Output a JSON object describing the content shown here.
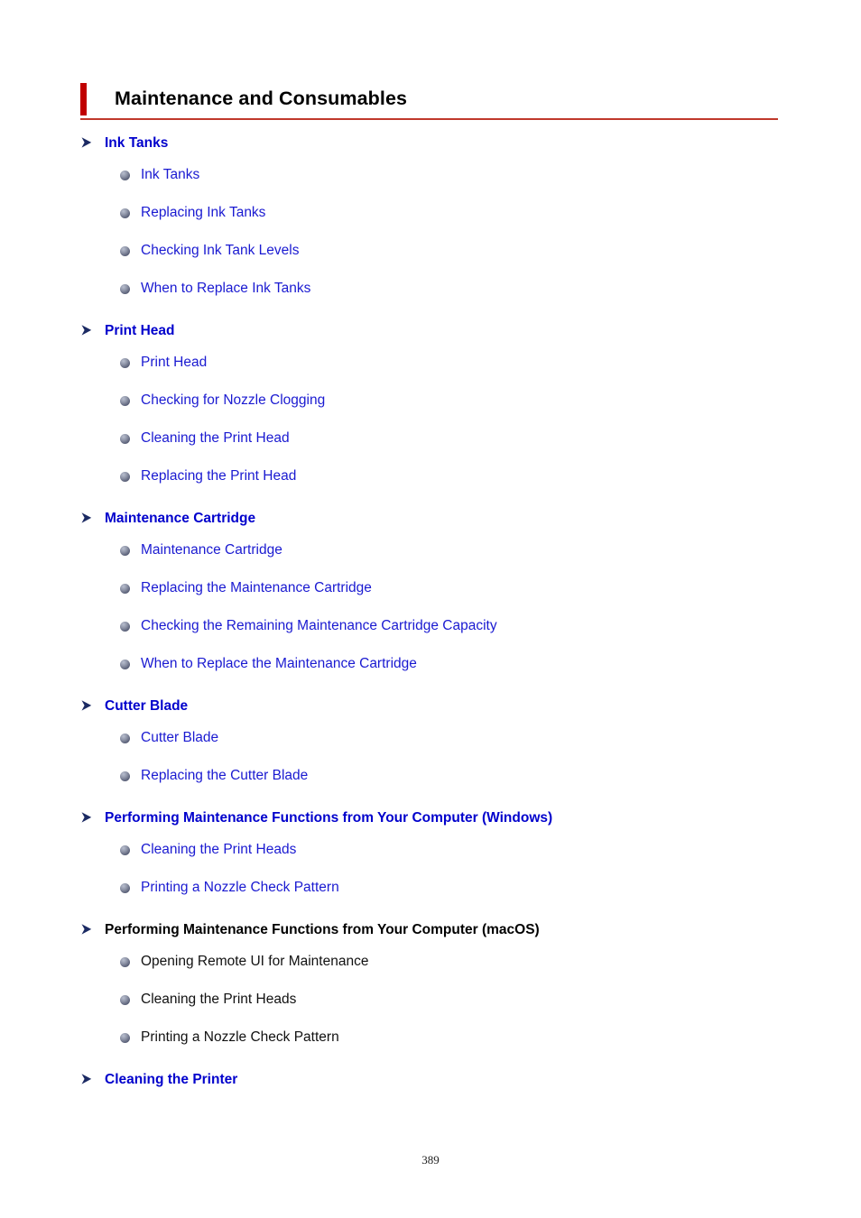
{
  "document": {
    "title": "Maintenance and Consumables",
    "page_number": "389",
    "accent_bar_color": "#c00000",
    "rule_color": "#c0392b",
    "link_color": "#0000cc",
    "plain_text_color": "#000000"
  },
  "icons": {
    "section_arrow": "arrow-right-icon",
    "bullet": "sphere-bullet-icon"
  },
  "sections": [
    {
      "heading": "Ink Tanks",
      "heading_style": "link",
      "items": [
        {
          "label": "Ink Tanks",
          "style": "link"
        },
        {
          "label": "Replacing Ink Tanks",
          "style": "link"
        },
        {
          "label": "Checking Ink Tank Levels",
          "style": "link"
        },
        {
          "label": "When to Replace Ink Tanks",
          "style": "link"
        }
      ]
    },
    {
      "heading": "Print Head",
      "heading_style": "link",
      "items": [
        {
          "label": "Print Head",
          "style": "link"
        },
        {
          "label": "Checking for Nozzle Clogging",
          "style": "link"
        },
        {
          "label": "Cleaning the Print Head",
          "style": "link"
        },
        {
          "label": "Replacing the Print Head",
          "style": "link"
        }
      ]
    },
    {
      "heading": "Maintenance Cartridge",
      "heading_style": "link",
      "items": [
        {
          "label": "Maintenance Cartridge",
          "style": "link"
        },
        {
          "label": "Replacing the Maintenance Cartridge",
          "style": "link"
        },
        {
          "label": "Checking the Remaining Maintenance Cartridge Capacity",
          "style": "link"
        },
        {
          "label": "When to Replace the Maintenance Cartridge",
          "style": "link"
        }
      ]
    },
    {
      "heading": "Cutter Blade",
      "heading_style": "link",
      "items": [
        {
          "label": "Cutter Blade",
          "style": "link"
        },
        {
          "label": "Replacing the Cutter Blade",
          "style": "link"
        }
      ]
    },
    {
      "heading": "Performing Maintenance Functions from Your Computer (Windows)",
      "heading_style": "link",
      "items": [
        {
          "label": "Cleaning the Print Heads",
          "style": "link"
        },
        {
          "label": "Printing a Nozzle Check Pattern",
          "style": "link"
        }
      ]
    },
    {
      "heading": "Performing Maintenance Functions from Your Computer (macOS)",
      "heading_style": "plain",
      "items": [
        {
          "label": "Opening Remote UI for Maintenance",
          "style": "plain"
        },
        {
          "label": "Cleaning the Print Heads",
          "style": "plain"
        },
        {
          "label": "Printing a Nozzle Check Pattern",
          "style": "plain"
        }
      ]
    },
    {
      "heading": "Cleaning the Printer",
      "heading_style": "link",
      "items": []
    }
  ]
}
